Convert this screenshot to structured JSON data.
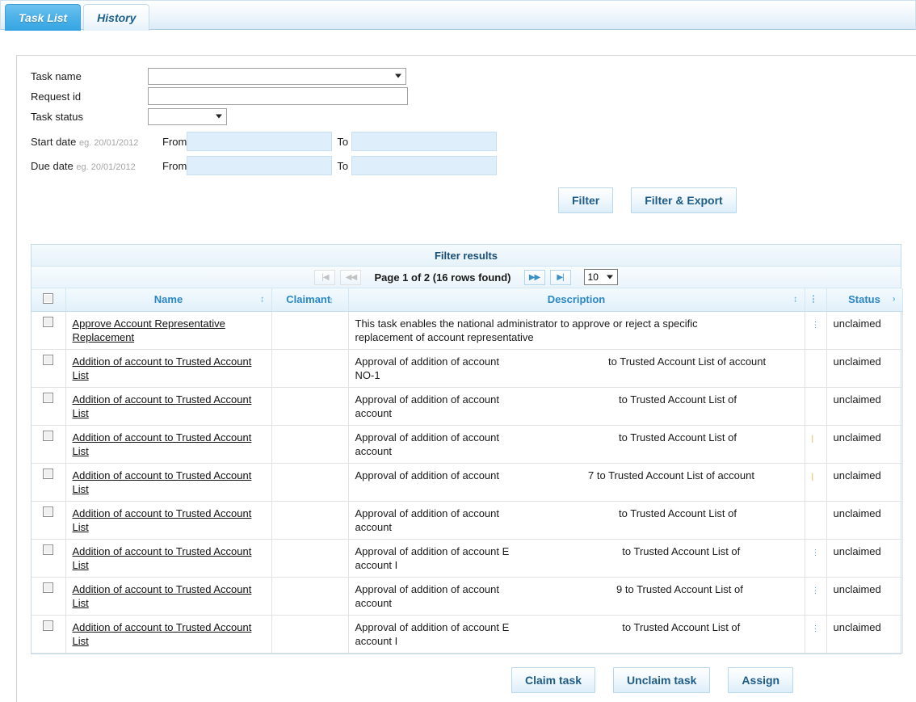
{
  "tabs": [
    {
      "label": "Task List",
      "active": true
    },
    {
      "label": "History",
      "active": false
    }
  ],
  "form": {
    "task_name_label": "Task name",
    "task_name_value": "",
    "request_id_label": "Request id",
    "request_id_value": "",
    "task_status_label": "Task status",
    "task_status_value": "",
    "start_date_label": "Start date",
    "start_date_hint": "eg. 20/01/2012",
    "due_date_label": "Due date",
    "due_date_hint": "eg. 20/01/2012",
    "from_label": "From",
    "to_label": "To",
    "start_from_value": "",
    "start_to_value": "",
    "due_from_value": "",
    "due_to_value": ""
  },
  "filter_buttons": {
    "filter": "Filter",
    "filter_export": "Filter & Export"
  },
  "results": {
    "title": "Filter results",
    "pagination": {
      "first": "|◀",
      "prev": "◀◀",
      "text": "Page 1 of 2 (16 rows found)",
      "next": "▶▶",
      "last": "▶|",
      "page_size": "10"
    },
    "columns": {
      "name": "Name",
      "claimant": "Claimant",
      "description": "Description",
      "status": "Status"
    },
    "rows": [
      {
        "name": "Approve Account Representative Replacement",
        "claimant": "",
        "desc_line1": "This task enables the national administrator to approve or reject a specific",
        "desc_line2": "replacement of account representative",
        "desc_gap": "",
        "desc_tail": "",
        "status": "unclaimed"
      },
      {
        "name": "Addition of account to Trusted Account List",
        "claimant": "",
        "desc_line1": "Approval of addition of account",
        "desc_gap": "",
        "desc_tail": "to Trusted Account List of account",
        "desc_line2": "NO-1",
        "status": "unclaimed"
      },
      {
        "name": "Addition of account to Trusted Account List",
        "claimant": "",
        "desc_line1": "Approval of addition of account",
        "desc_gap": "",
        "desc_tail": "to Trusted Account List of",
        "desc_line2": "account",
        "status": "unclaimed"
      },
      {
        "name": "Addition of account to Trusted Account List",
        "claimant": "",
        "desc_line1": "Approval of addition of account",
        "desc_gap": "",
        "desc_tail": "to Trusted Account List of",
        "desc_line2": "account",
        "status": "unclaimed"
      },
      {
        "name": "Addition of account to Trusted Account List",
        "claimant": "",
        "desc_line1": "Approval of addition of account",
        "desc_gap": "",
        "desc_tail": "7 to Trusted Account List of account",
        "desc_line2": "",
        "status": "unclaimed"
      },
      {
        "name": "Addition of account to Trusted Account List",
        "claimant": "",
        "desc_line1": "Approval of addition of account",
        "desc_gap": "",
        "desc_tail": "to Trusted Account List of",
        "desc_line2": "account",
        "status": "unclaimed"
      },
      {
        "name": "Addition of account to Trusted Account List",
        "claimant": "",
        "desc_line1": "Approval of addition of account E",
        "desc_gap": "",
        "desc_tail": "to Trusted Account List of",
        "desc_line2": "account I",
        "status": "unclaimed"
      },
      {
        "name": "Addition of account to Trusted Account List",
        "claimant": "",
        "desc_line1": "Approval of addition of account",
        "desc_gap": "",
        "desc_tail": "9 to Trusted Account List of",
        "desc_line2": "account",
        "status": "unclaimed"
      },
      {
        "name": "Addition of account to Trusted Account List",
        "claimant": "",
        "desc_line1": "Approval of addition of account E",
        "desc_gap": "",
        "desc_tail": "to Trusted Account List of",
        "desc_line2": "account I",
        "status": "unclaimed"
      }
    ]
  },
  "actions": {
    "claim": "Claim task",
    "unclaim": "Unclaim task",
    "assign": "Assign"
  },
  "colors": {
    "tab_active_start": "#6ec2ef",
    "tab_active_end": "#34a5e2",
    "header_text": "#2b87c4",
    "button_text": "#1e5c88",
    "date_field_bg": "#dfeefb"
  }
}
